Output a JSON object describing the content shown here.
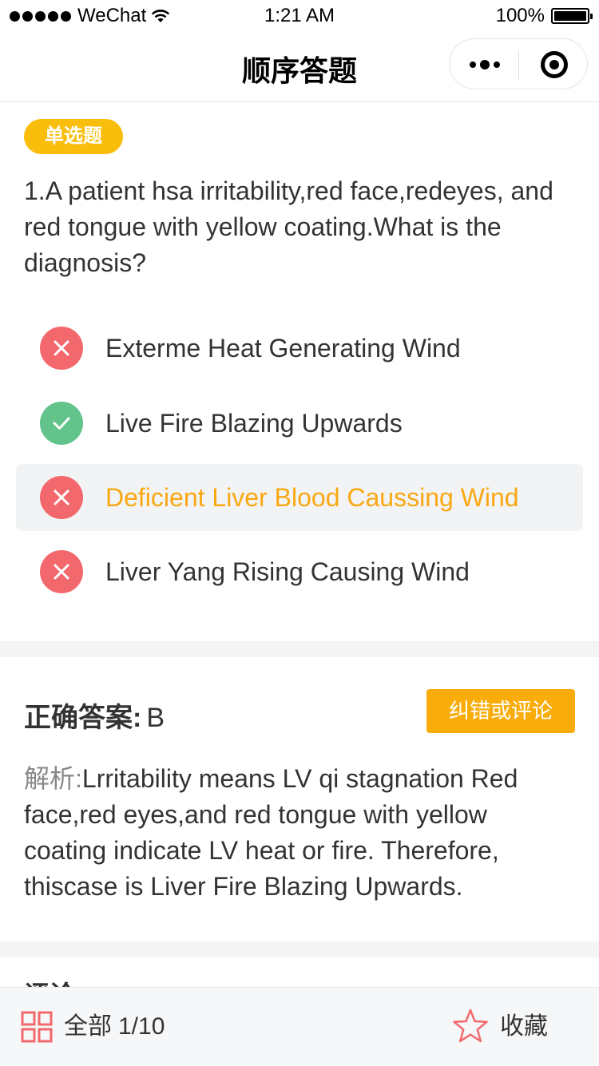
{
  "status_bar": {
    "carrier": "WeChat",
    "time": "1:21 AM",
    "battery": "100%"
  },
  "nav": {
    "title": "顺序答题"
  },
  "question": {
    "type_badge": "单选题",
    "text": "1.A patient hsa irritability,red face,redeyes, and red tongue with yellow coating.What is the diagnosis?",
    "options": [
      {
        "label": "Exterme Heat Generating Wind",
        "state": "wrong",
        "icon": "cross-icon"
      },
      {
        "label": "Live Fire Blazing Upwards",
        "state": "right",
        "icon": "check-icon"
      },
      {
        "label": "Deficient Liver Blood Caussing Wind",
        "state": "wrong-selected",
        "icon": "cross-icon"
      },
      {
        "label": "Liver Yang Rising Causing Wind",
        "state": "wrong",
        "icon": "cross-icon"
      }
    ]
  },
  "answer": {
    "correct_label": "正确答案:",
    "correct_value": "B",
    "comment_button": "纠错或评论",
    "analysis_label": "解析:",
    "analysis_text": "Lrritability means LV qi stagnation Red face,red eyes,and red tongue with yellow coating indicate LV heat or fire. Therefore, thiscase is Liver Fire Blazing Upwards."
  },
  "comments": {
    "title": "评论"
  },
  "bottom_bar": {
    "all_label": "全部",
    "progress": "1/10",
    "favorite_label": "收藏"
  },
  "colors": {
    "badge": "#f9bd0c",
    "wrong": "#f3686d",
    "right": "#62c38b",
    "selected_text": "#f9a812",
    "button": "#f9ac0a"
  }
}
